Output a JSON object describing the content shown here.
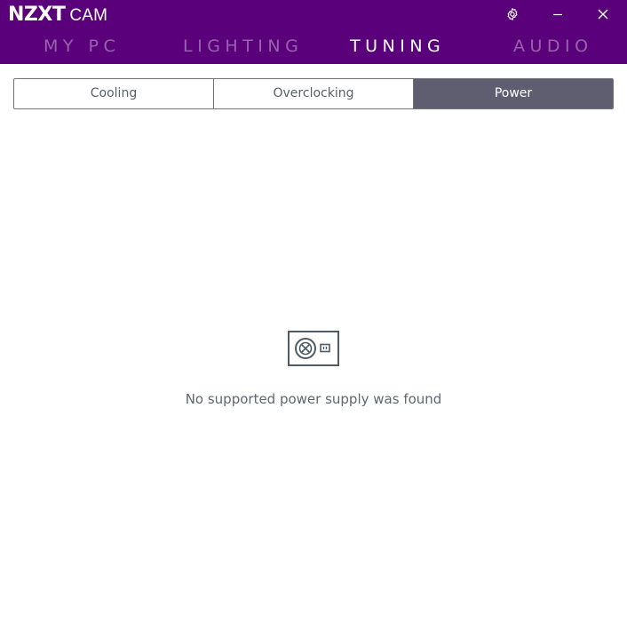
{
  "app": {
    "brand": "NZXT",
    "product": "CAM"
  },
  "window_controls": {
    "settings_icon": "gear-icon",
    "minimize_icon": "minimize-icon",
    "close_icon": "close-icon"
  },
  "nav": {
    "tabs": [
      {
        "label": "MY PC",
        "active": false
      },
      {
        "label": "LIGHTING",
        "active": false
      },
      {
        "label": "TUNING",
        "active": true
      },
      {
        "label": "AUDIO",
        "active": false
      }
    ]
  },
  "tuning": {
    "segments": [
      {
        "label": "Cooling",
        "active": false
      },
      {
        "label": "Overclocking",
        "active": false
      },
      {
        "label": "Power",
        "active": true
      }
    ]
  },
  "empty_state": {
    "icon": "power-supply-icon",
    "message": "No supported power supply was found"
  },
  "colors": {
    "header_bg": "#59007a",
    "active_segment_bg": "#5f5d70",
    "icon_stroke": "#4e5a66",
    "message_text": "#5e6770"
  }
}
